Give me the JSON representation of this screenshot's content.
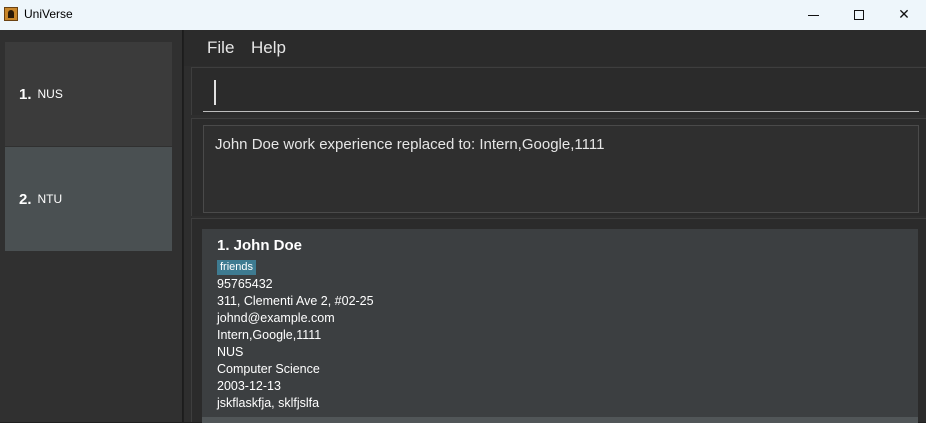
{
  "window": {
    "title": "UniVerse",
    "minimize_symbol": "",
    "close_symbol": "✕"
  },
  "sidebar": {
    "items": [
      {
        "index": "1.",
        "name": "NUS",
        "selected": false
      },
      {
        "index": "2.",
        "name": "NTU",
        "selected": true
      }
    ]
  },
  "menu": {
    "file": "File",
    "help": "Help"
  },
  "command": {
    "value": "",
    "placeholder": ""
  },
  "result": {
    "message": "John Doe work experience replaced to: Intern,Google,1111"
  },
  "person_list": {
    "cards": [
      {
        "index": "1.",
        "name": "John Doe",
        "header": "1. John Doe",
        "tags": [
          "friends"
        ],
        "phone": "95765432",
        "address": "311, Clementi Ave 2, #02-25",
        "email": "johnd@example.com",
        "work_experience": "Intern,Google,1111",
        "university": "NUS",
        "major": "Computer Science",
        "birthday": "2003-12-13",
        "interests": "jskflaskfja, sklfjslfa"
      }
    ]
  },
  "colors": {
    "titlebar_bg": "#eef6fb",
    "sidebar_bg": "#303030",
    "selected_item_bg": "#4a5052",
    "card_bg": "#3c3f41",
    "tag_bg": "#3e7b91"
  }
}
